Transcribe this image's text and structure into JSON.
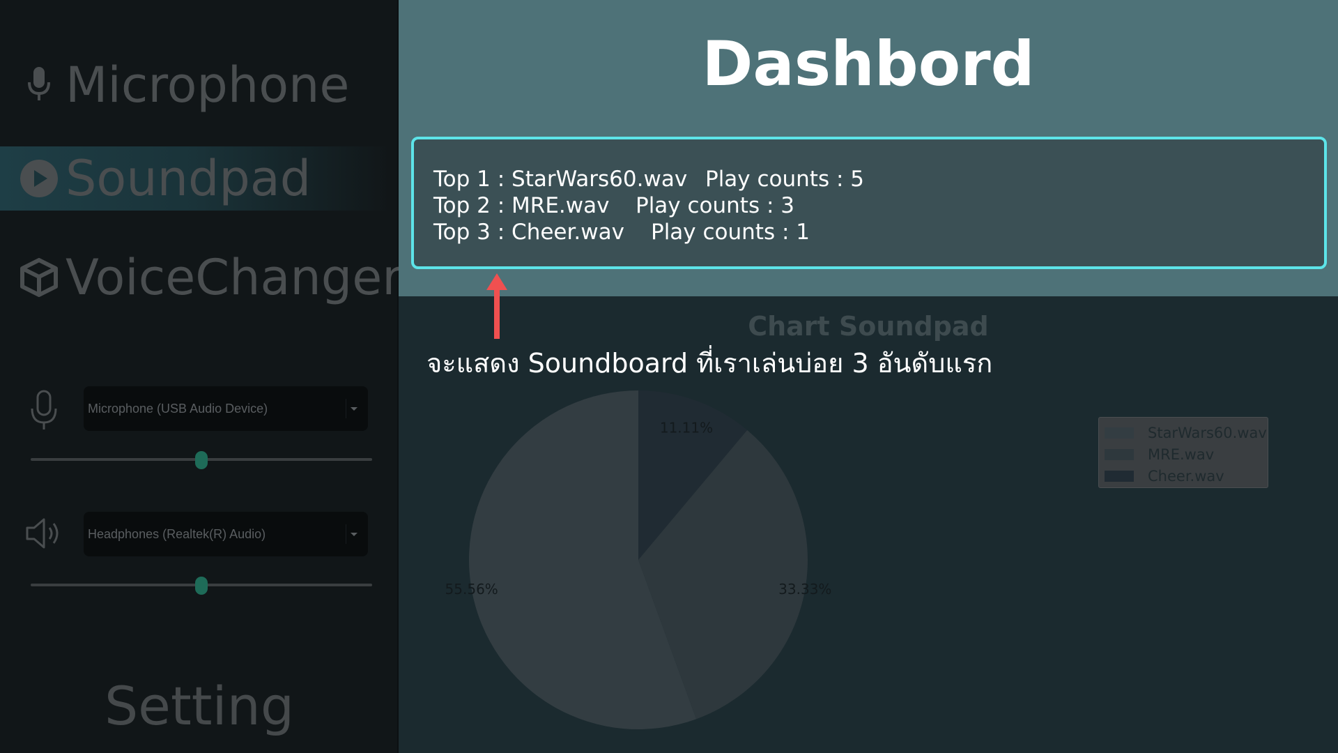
{
  "sidebar": {
    "nav": [
      {
        "label": "Microphone",
        "icon": "microphone-icon"
      },
      {
        "label": "Soundpad",
        "icon": "play-circle-icon"
      },
      {
        "label": "VoiceChanger",
        "icon": "cube-icon"
      }
    ],
    "input_device": {
      "icon": "microphone-outline-icon",
      "value": "Microphone (USB Audio Device)",
      "volume_percent": 50
    },
    "output_device": {
      "icon": "speaker-icon",
      "value": "Headphones (Realtek(R) Audio)",
      "volume_percent": 50
    },
    "setting_label": "Setting"
  },
  "main": {
    "title": "Dashbord",
    "top_list": [
      {
        "rank": "Top 1 : StarWars60.wav",
        "count": "Play counts : 5"
      },
      {
        "rank": "Top 2 : MRE.wav",
        "count": "Play counts : 3"
      },
      {
        "rank": "Top 3 : Cheer.wav",
        "count": "Play counts : 1"
      }
    ],
    "annotation": "จะแสดง Soundboard ที่เราเล่นบ่อย 3 อันดับแรก"
  },
  "colors": {
    "accent_border": "#5de4e9",
    "active_nav": "#1e3e46",
    "header_bg": "#4e7278",
    "annotation_arrow": "#f05050",
    "slider_thumb": "#1e6b58"
  },
  "chart_data": {
    "type": "pie",
    "title": "Chart Soundpad",
    "legend_position": "top-right",
    "slices": [
      {
        "label": "StarWars60.wav",
        "value": 5,
        "percent_label": "55.56%",
        "color": "#333d42"
      },
      {
        "label": "MRE.wav",
        "value": 3,
        "percent_label": "33.33%",
        "color": "#2e383d"
      },
      {
        "label": "Cheer.wav",
        "value": 1,
        "percent_label": "11.11%",
        "color": "#202b33"
      }
    ]
  }
}
